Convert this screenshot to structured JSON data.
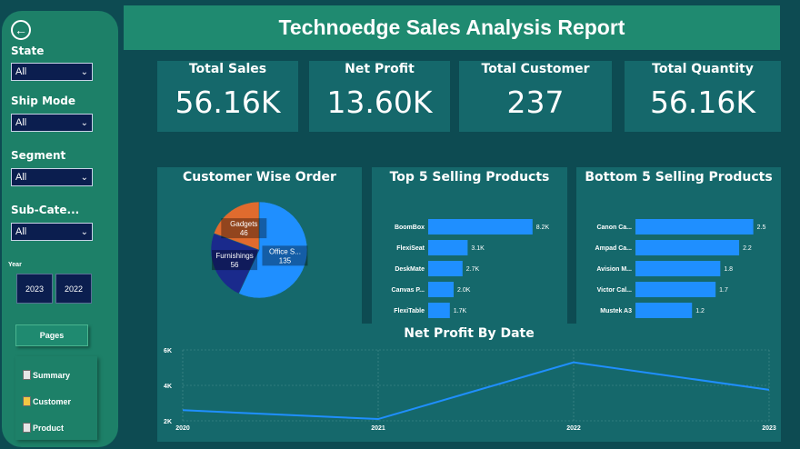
{
  "report_title": "Technoedge Sales Analysis Report",
  "sidebar": {
    "back_icon": "back-arrow-icon",
    "slicers": [
      {
        "label": "State",
        "value": "All"
      },
      {
        "label": "Ship Mode",
        "value": "All"
      },
      {
        "label": "Segment",
        "value": "All"
      },
      {
        "label": "Sub-Cate...",
        "value": "All"
      }
    ],
    "year_label": "Year",
    "years": [
      "2023",
      "2022"
    ],
    "pages_label": "Pages",
    "nav": [
      {
        "label": "Summary",
        "icon": "clipboard-icon"
      },
      {
        "label": "Customer",
        "icon": "customer-icon"
      },
      {
        "label": "Product",
        "icon": "clipboard-icon"
      }
    ]
  },
  "kpis": [
    {
      "label": "Total Sales",
      "value": "56.16K"
    },
    {
      "label": "Net Profit",
      "value": "13.60K"
    },
    {
      "label": "Total Customer",
      "value": "237"
    },
    {
      "label": "Total Quantity",
      "value": "56.16K"
    }
  ],
  "chart_data": [
    {
      "type": "pie",
      "title": "Customer Wise Order",
      "slices": [
        {
          "name": "Office S...",
          "value": 135,
          "color": "#1f8fff"
        },
        {
          "name": "Furnishings",
          "value": 56,
          "color": "#1a2a8c"
        },
        {
          "name": "Gadgets",
          "value": 46,
          "color": "#e06b2e"
        }
      ]
    },
    {
      "type": "bar",
      "title": "Top 5 Selling Products",
      "categories": [
        "BoomBox",
        "FlexiSeat",
        "DeskMate",
        "Canvas P...",
        "FlexiTable"
      ],
      "values": [
        8200,
        3100,
        2700,
        2000,
        1700
      ],
      "value_labels": [
        "8.2K",
        "3.1K",
        "2.7K",
        "2.0K",
        "1.7K"
      ],
      "xlim": [
        0,
        10000
      ],
      "xticks": [
        "0K",
        "5K",
        "10K"
      ],
      "color": "#1f8fff"
    },
    {
      "type": "bar",
      "title": "Bottom 5 Selling Products",
      "categories": [
        "Canon Ca...",
        "Ampad Ca...",
        "Avision M...",
        "Victor Cal...",
        "Mustek A3"
      ],
      "values": [
        2.5,
        2.2,
        1.8,
        1.7,
        1.2
      ],
      "value_labels": [
        "2.5",
        "2.2",
        "1.8",
        "1.7",
        "1.2"
      ],
      "xlim": [
        0,
        2.7
      ],
      "xticks": [
        "0",
        "2"
      ],
      "color": "#1f8fff"
    },
    {
      "type": "line",
      "title": "Net Profit By Date",
      "x": [
        "2020",
        "2021",
        "2022",
        "2023"
      ],
      "values": [
        2600,
        2100,
        5300,
        3750
      ],
      "ylim": [
        2000,
        6000
      ],
      "yticks": [
        "2K",
        "4K",
        "6K"
      ],
      "grid": true,
      "color": "#1f8fff"
    }
  ]
}
